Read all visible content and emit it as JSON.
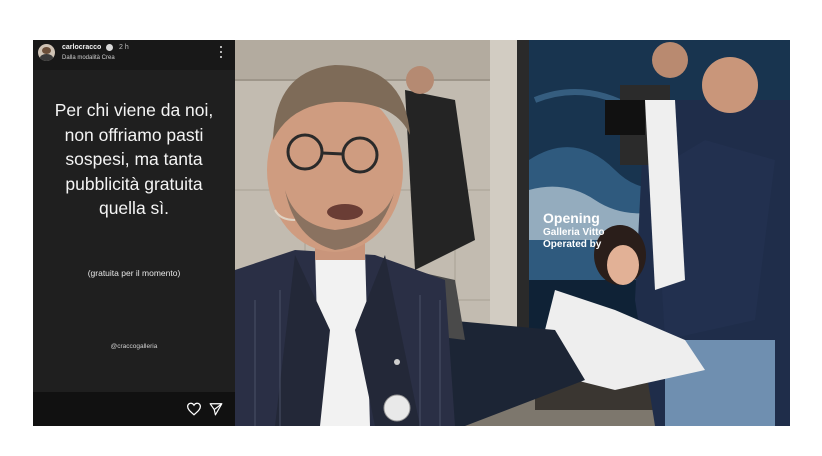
{
  "story": {
    "username": "carlocracco",
    "time": "2 h",
    "subtitle": "Dalla modalità Crea",
    "main_lines": [
      "Per chi viene da noi,",
      "non offriamo pasti",
      "sospesi, ma tanta",
      "pubblicità gratuita",
      "quella sì."
    ],
    "note": "(gratuita per il momento)",
    "mention": "@craccogalleria",
    "icons": {
      "menu": "more-vertical-icon",
      "like": "heart-icon",
      "share": "send-icon"
    }
  },
  "photo": {
    "ad_lines": {
      "opening": "Opening",
      "gallery": "Galleria Vitto",
      "operated": "Operated by"
    },
    "colors": {
      "wall": "#bfb8ad",
      "billboard": "#1c3a55",
      "suit": "#2a2f45",
      "jacket_navy": "#1f2d4a"
    }
  }
}
